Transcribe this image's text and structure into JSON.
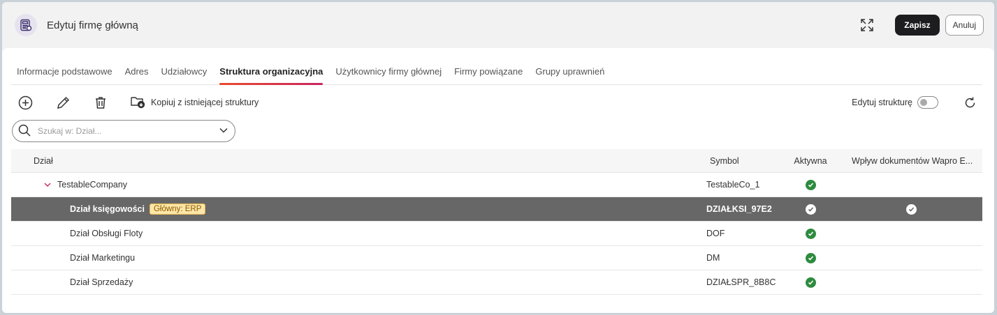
{
  "header": {
    "title": "Edytuj firmę główną",
    "save_label": "Zapisz",
    "cancel_label": "Anuluj"
  },
  "tabs": [
    {
      "label": "Informacje podstawowe",
      "active": false
    },
    {
      "label": "Adres",
      "active": false
    },
    {
      "label": "Udziałowcy",
      "active": false
    },
    {
      "label": "Struktura organizacyjna",
      "active": true
    },
    {
      "label": "Użytkownicy firmy głównej",
      "active": false
    },
    {
      "label": "Firmy powiązane",
      "active": false
    },
    {
      "label": "Grupy uprawnień",
      "active": false
    }
  ],
  "toolbar": {
    "copy_label": "Kopiuj z istniejącej struktury",
    "edit_structure_label": "Edytuj strukturę",
    "edit_structure_on": false
  },
  "search": {
    "placeholder": "Szukaj w: Dział..."
  },
  "grid": {
    "columns": {
      "name": "Dział",
      "symbol": "Symbol",
      "active": "Aktywna",
      "wapro": "Wpływ dokumentów Wapro E..."
    },
    "rows": [
      {
        "name": "TestableCompany",
        "symbol": "TestableCo_1",
        "active": true,
        "wapro": false,
        "level": 0,
        "expanded": true,
        "selected": false,
        "badge": ""
      },
      {
        "name": "Dział księgowości",
        "symbol": "DZIAŁKSI_97E2",
        "active": true,
        "wapro": true,
        "level": 1,
        "selected": true,
        "badge": "Główny: ERP"
      },
      {
        "name": "Dział Obsługi Floty",
        "symbol": "DOF",
        "active": true,
        "wapro": false,
        "level": 1,
        "selected": false,
        "badge": ""
      },
      {
        "name": "Dział Marketingu",
        "symbol": "DM",
        "active": true,
        "wapro": false,
        "level": 1,
        "selected": false,
        "badge": ""
      },
      {
        "name": "Dział Sprzedaży",
        "symbol": "DZIAŁSPR_8B8C",
        "active": true,
        "wapro": false,
        "level": 1,
        "selected": false,
        "badge": ""
      }
    ]
  },
  "colors": {
    "accent": "#e84a2e",
    "check_green": "#2e8b3f",
    "selected_row": "#676767",
    "badge_bg": "#fde6a8"
  },
  "icons": {
    "app": "calculator-icon",
    "expand": "expand-icon",
    "add": "add-circle-icon",
    "edit": "pencil-icon",
    "delete": "trash-icon",
    "copy": "folder-copy-icon",
    "refresh": "refresh-icon",
    "search": "search-icon",
    "dropdown": "chevron-down-icon"
  }
}
